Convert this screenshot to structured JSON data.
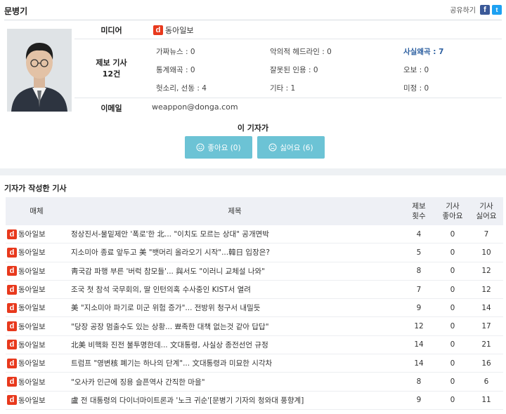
{
  "header": {
    "reporter_name": "문병기",
    "share_label": "공유하기",
    "facebook_icon_glyph": "f",
    "twitter_icon_glyph": "t"
  },
  "profile": {
    "media_label": "미디어",
    "media_name": "동아일보",
    "media_logo_glyph": "d",
    "report_label": "제보 기사",
    "report_count": "12건",
    "stats": [
      {
        "label": "가짜뉴스 : 0",
        "highlight": false
      },
      {
        "label": "악의적 헤드라인 : 0",
        "highlight": false
      },
      {
        "label": "사실왜곡 : 7",
        "highlight": true
      },
      {
        "label": "통계왜곡 : 0",
        "highlight": false
      },
      {
        "label": "잘못된 인용 : 0",
        "highlight": false
      },
      {
        "label": "오보 : 0",
        "highlight": false
      },
      {
        "label": "헛소리, 선동 : 4",
        "highlight": false
      },
      {
        "label": "기타 : 1",
        "highlight": false
      },
      {
        "label": "미정 : 0",
        "highlight": false
      }
    ],
    "email_label": "이메일",
    "email": "weappon@donga.com"
  },
  "vote": {
    "title": "이 기자가",
    "like_label": "좋아요 (0)",
    "dislike_label": "싫어요 (6)"
  },
  "articles": {
    "section_title": "기자가 작성한 기사",
    "columns": {
      "media": "매체",
      "title": "제목",
      "report_count": "제보\n횟수",
      "likes": "기사\n좋아요",
      "dislikes": "기사\n싫어요"
    },
    "rows": [
      {
        "media": "동아일보",
        "title": "정상진서-물밑제안 '폭로'한 北... \"이치도 모르는 상대\" 공개면박",
        "reports": "4",
        "likes": "0",
        "dislikes": "7"
      },
      {
        "media": "동아일보",
        "title": "지소미아 종료 앞두고 美 \"뱃머리 올라오기 시작\"...韓日 입장은?",
        "reports": "5",
        "likes": "0",
        "dislikes": "10"
      },
      {
        "media": "동아일보",
        "title": "靑국감 파행 부른 '버럭 참모들'... 與서도 \"이러니 교체설 나와\"",
        "reports": "8",
        "likes": "0",
        "dislikes": "12"
      },
      {
        "media": "동아일보",
        "title": "조국 첫 참석 국무회의, 딸 인턴의혹 수사중인 KIST서 열려",
        "reports": "7",
        "likes": "0",
        "dislikes": "12"
      },
      {
        "media": "동아일보",
        "title": "美 \"지소미아 파기로 미군 위험 증가\"... 전방위 청구서 내밀듯",
        "reports": "9",
        "likes": "0",
        "dislikes": "14"
      },
      {
        "media": "동아일보",
        "title": "\"당장 공장 멈출수도 있는 상황... 뾰족한 대책 없는것 같아 답답\"",
        "reports": "12",
        "likes": "0",
        "dislikes": "17"
      },
      {
        "media": "동아일보",
        "title": "北美 비핵화 진전 불투명한데... 文대통령, 사실상 종전선언 규정",
        "reports": "14",
        "likes": "0",
        "dislikes": "21"
      },
      {
        "media": "동아일보",
        "title": "트럼프 \"영변核 폐기는 하나의 단계\"... 文대통령과 미묘한 시각차",
        "reports": "14",
        "likes": "0",
        "dislikes": "16"
      },
      {
        "media": "동아일보",
        "title": "\"오사카 인근에 징용 슬픈역사 간직한 마을\"",
        "reports": "8",
        "likes": "0",
        "dislikes": "6"
      },
      {
        "media": "동아일보",
        "title": "盧 전 대통령의 다이너마이트론과 '노크 귀순'[문병기 기자의 청와대 풍향계]",
        "reports": "9",
        "likes": "0",
        "dislikes": "11"
      }
    ]
  },
  "colors": {
    "accent_button": "#6cc3d5",
    "logo_red": "#e8391d",
    "highlight_blue": "#2c5fa0",
    "facebook_blue": "#3b5998",
    "twitter_blue": "#1da1f2"
  }
}
